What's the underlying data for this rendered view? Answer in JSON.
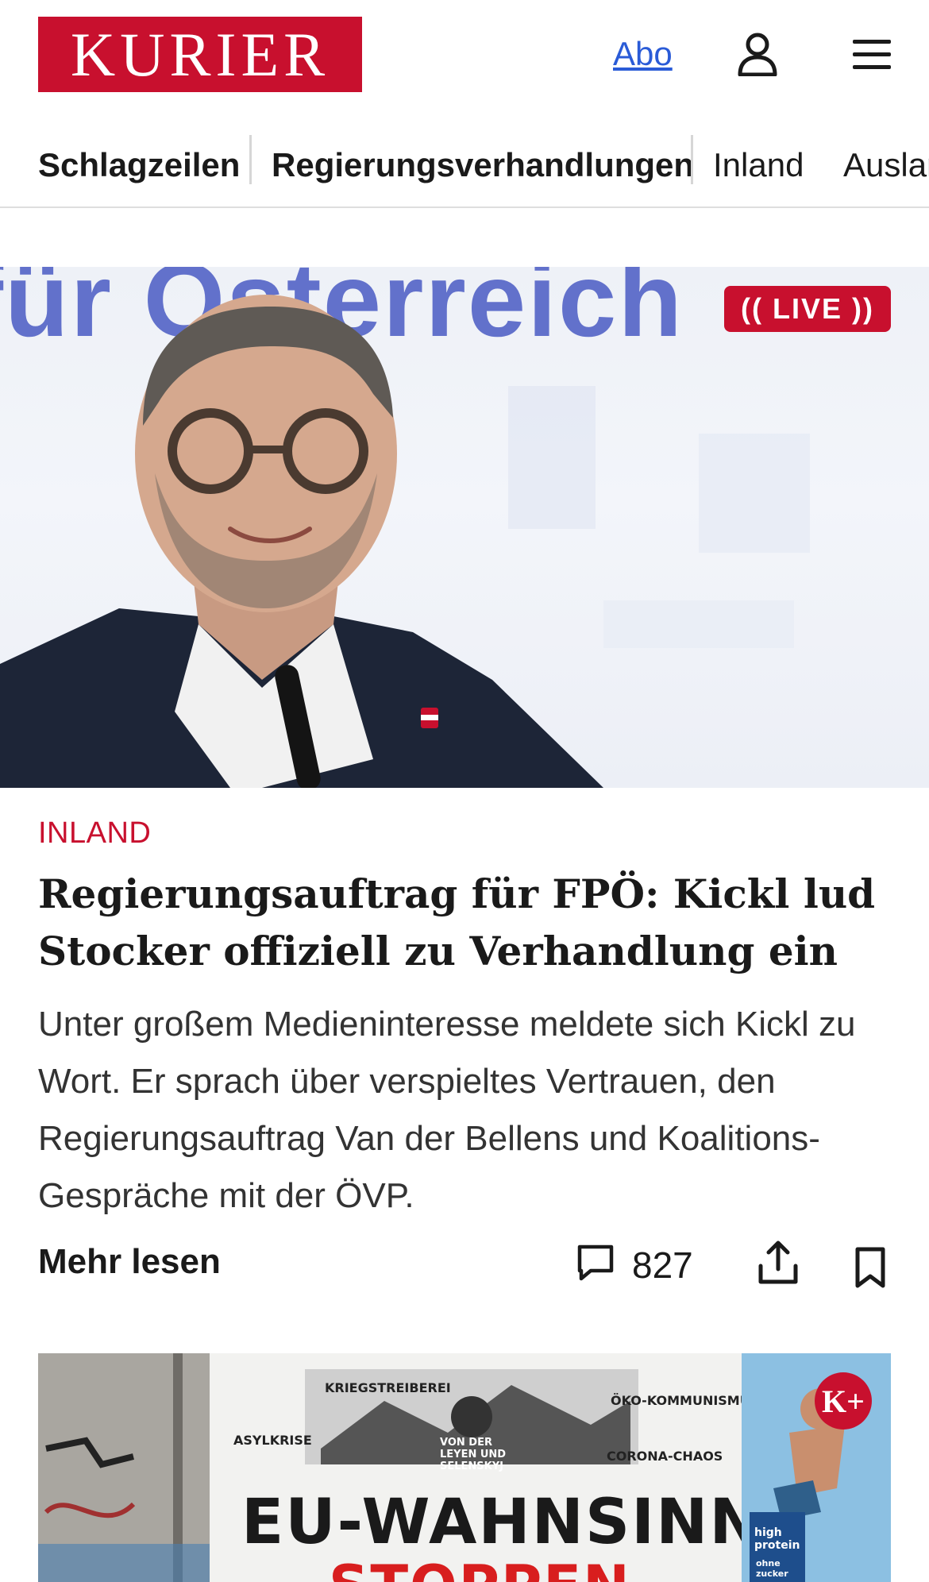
{
  "header": {
    "logo_text": "KURIER",
    "abo_label": "Abo",
    "user_icon": "user-icon",
    "menu_icon": "hamburger-menu-icon"
  },
  "nav": {
    "items": [
      {
        "label": "Schlagzeilen",
        "bold": true
      },
      {
        "label": "Regierungsverhandlungen",
        "bold": true
      },
      {
        "label": "Inland",
        "bold": false
      },
      {
        "label": "Ausland",
        "bold": false
      }
    ]
  },
  "hero": {
    "background_text": "für Österreich",
    "live_label": "(( LIVE ))"
  },
  "article": {
    "category": "INLAND",
    "headline": "Regierungsauftrag für FPÖ: Kickl lud Stocker offiziell zu Verhandlung ein",
    "teaser": "Unter großem Medieninteresse meldete sich Kickl zu Wort. Er sprach über verspieltes Vertrauen, den Regierungsauftrag Van der Bellens und Koalitions-Gespräche mit der ÖVP.",
    "more_label": "Mehr lesen",
    "comment_count": "827",
    "comment_icon": "comment-icon",
    "share_icon": "share-icon",
    "bookmark_icon": "bookmark-icon"
  },
  "teaser_image": {
    "poster_labels": [
      "KRIEGSTREIBEREI",
      "ÖKO-KOMMUNISMUS",
      "ASYLKRISE",
      "VON DER LEYEN UND SELENSKYJ",
      "CORONA-CHAOS"
    ],
    "poster_headline": "EU-WAHNSINN",
    "poster_subline": "STOPPEN",
    "ad_text": "high protein",
    "ad_text2": "ohne zucker",
    "badge": "K+"
  },
  "colors": {
    "brand_red": "#c8102e",
    "link_blue": "#2a5bd7"
  }
}
